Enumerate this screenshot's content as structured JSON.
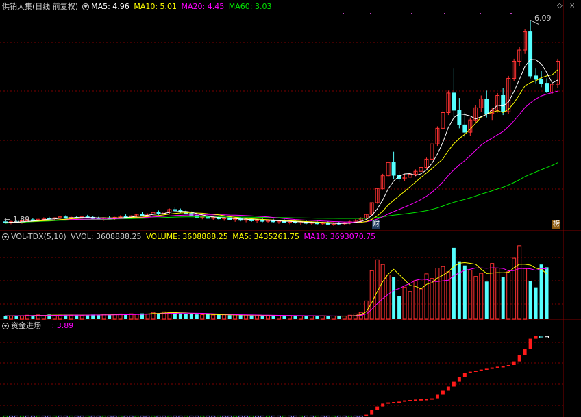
{
  "main_header": {
    "title": "供销大集(日线 前复权)",
    "ma5": "MA5: 4.96",
    "ma10": "MA10: 5.01",
    "ma20": "MA20: 4.45",
    "ma60": "MA60: 3.03"
  },
  "vol_header": {
    "name": "VOL-TDX(5,10)",
    "vvol": "VVOL: 3608888.25",
    "volume": "VOLUME: 3608888.25",
    "ma5": "MA5: 3435261.75",
    "ma10": "MA10: 3693070.75"
  },
  "fund_header": {
    "name": "资金进场",
    "value": ": 3.89"
  },
  "annotations": {
    "high_price": "6.09",
    "low_price": "1.89",
    "tag_cai": "财",
    "tag_bang": "榜"
  },
  "controls": {
    "diamond": "◇",
    "close": "×"
  },
  "colors": {
    "up": "#ff3232",
    "down": "#54ffff",
    "ma5": "#ffffff",
    "ma10": "#ffff00",
    "ma20": "#ff00ff",
    "ma60": "#00e600",
    "grid": "#800000",
    "text": "#c8c8c8"
  },
  "chart_data": [
    {
      "type": "candlestick",
      "title": "供销大集(日线 前复权)",
      "series": [
        {
          "name": "K线",
          "ohlc": [
            [
              1.97,
              2.0,
              1.93,
              1.95
            ],
            [
              1.95,
              1.99,
              1.92,
              1.97
            ],
            [
              1.97,
              2.01,
              1.94,
              1.96
            ],
            [
              1.96,
              2.0,
              1.93,
              1.99
            ],
            [
              1.99,
              2.03,
              1.96,
              2.01
            ],
            [
              2.01,
              2.05,
              1.98,
              2.0
            ],
            [
              2.0,
              2.03,
              1.97,
              2.02
            ],
            [
              2.02,
              2.06,
              1.99,
              2.04
            ],
            [
              2.04,
              2.07,
              2.01,
              2.03
            ],
            [
              2.03,
              2.06,
              2.0,
              2.05
            ],
            [
              2.05,
              2.09,
              2.02,
              2.07
            ],
            [
              2.07,
              2.1,
              2.03,
              2.04
            ],
            [
              2.04,
              2.08,
              2.01,
              2.06
            ],
            [
              2.06,
              2.09,
              2.03,
              2.05
            ],
            [
              2.05,
              2.08,
              2.02,
              2.07
            ],
            [
              2.07,
              2.11,
              2.04,
              2.06
            ],
            [
              2.06,
              2.09,
              2.02,
              2.04
            ],
            [
              2.04,
              2.07,
              2.0,
              2.02
            ],
            [
              2.02,
              2.06,
              1.99,
              2.05
            ],
            [
              2.05,
              2.08,
              2.02,
              2.03
            ],
            [
              2.03,
              2.07,
              2.0,
              2.06
            ],
            [
              2.06,
              2.1,
              2.03,
              2.08
            ],
            [
              2.08,
              2.12,
              2.05,
              2.07
            ],
            [
              2.07,
              2.1,
              2.03,
              2.09
            ],
            [
              2.09,
              2.13,
              2.06,
              2.12
            ],
            [
              2.12,
              2.17,
              2.08,
              2.1
            ],
            [
              2.1,
              2.14,
              2.06,
              2.13
            ],
            [
              2.13,
              2.18,
              2.09,
              2.16
            ],
            [
              2.16,
              2.2,
              2.11,
              2.14
            ],
            [
              2.14,
              2.18,
              2.1,
              2.17
            ],
            [
              2.17,
              2.24,
              2.13,
              2.22
            ],
            [
              2.22,
              2.27,
              2.18,
              2.2
            ],
            [
              2.2,
              2.24,
              2.15,
              2.17
            ],
            [
              2.17,
              2.21,
              2.12,
              2.14
            ],
            [
              2.14,
              2.18,
              2.09,
              2.1
            ],
            [
              2.1,
              2.14,
              2.04,
              2.06
            ],
            [
              2.06,
              2.1,
              2.02,
              2.08
            ],
            [
              2.08,
              2.11,
              2.03,
              2.04
            ],
            [
              2.04,
              2.08,
              2.0,
              2.06
            ],
            [
              2.06,
              2.09,
              2.01,
              2.03
            ],
            [
              2.03,
              2.07,
              1.99,
              2.05
            ],
            [
              2.05,
              2.08,
              2.0,
              2.01
            ],
            [
              2.01,
              2.05,
              1.97,
              2.03
            ],
            [
              2.03,
              2.06,
              1.98,
              2.0
            ],
            [
              2.0,
              2.04,
              1.96,
              2.02
            ],
            [
              2.02,
              2.05,
              1.97,
              1.99
            ],
            [
              1.99,
              2.03,
              1.95,
              2.01
            ],
            [
              2.01,
              2.04,
              1.96,
              1.98
            ],
            [
              1.98,
              2.02,
              1.94,
              2.0
            ],
            [
              2.0,
              2.03,
              1.95,
              1.97
            ],
            [
              1.97,
              2.01,
              1.93,
              1.99
            ],
            [
              1.99,
              2.02,
              1.94,
              1.96
            ],
            [
              1.96,
              2.0,
              1.92,
              1.98
            ],
            [
              1.98,
              2.01,
              1.93,
              1.95
            ],
            [
              1.95,
              1.99,
              1.91,
              1.97
            ],
            [
              1.97,
              2.0,
              1.92,
              1.94
            ],
            [
              1.94,
              1.98,
              1.91,
              1.96
            ],
            [
              1.96,
              1.99,
              1.91,
              1.93
            ],
            [
              1.93,
              1.97,
              1.9,
              1.95
            ],
            [
              1.95,
              1.98,
              1.9,
              1.92
            ],
            [
              1.92,
              1.96,
              1.89,
              1.94
            ],
            [
              1.94,
              1.97,
              1.9,
              1.93
            ],
            [
              1.93,
              1.97,
              1.9,
              1.95
            ],
            [
              1.95,
              1.99,
              1.92,
              1.97
            ],
            [
              1.97,
              2.02,
              1.94,
              2.0
            ],
            [
              2.0,
              2.06,
              1.97,
              2.04
            ],
            [
              2.04,
              2.12,
              2.01,
              2.12
            ],
            [
              2.12,
              2.36,
              2.1,
              2.36
            ],
            [
              2.36,
              2.65,
              2.34,
              2.65
            ],
            [
              2.65,
              2.95,
              2.63,
              2.91
            ],
            [
              2.91,
              3.2,
              2.88,
              3.18
            ],
            [
              3.18,
              3.4,
              2.85,
              2.92
            ],
            [
              2.92,
              3.0,
              2.78,
              2.85
            ],
            [
              2.85,
              2.94,
              2.8,
              2.88
            ],
            [
              2.88,
              2.98,
              2.84,
              2.94
            ],
            [
              2.94,
              3.04,
              2.9,
              3.0
            ],
            [
              3.0,
              3.12,
              2.96,
              3.08
            ],
            [
              3.08,
              3.28,
              3.05,
              3.25
            ],
            [
              3.25,
              3.6,
              3.22,
              3.56
            ],
            [
              3.56,
              3.92,
              3.52,
              3.88
            ],
            [
              3.88,
              4.25,
              3.85,
              4.2
            ],
            [
              4.2,
              4.65,
              4.15,
              4.6
            ],
            [
              4.6,
              5.1,
              4.1,
              4.25
            ],
            [
              4.25,
              4.5,
              3.88,
              3.95
            ],
            [
              3.95,
              4.2,
              3.7,
              3.8
            ],
            [
              3.8,
              4.1,
              3.72,
              4.05
            ],
            [
              4.05,
              4.35,
              4.0,
              4.3
            ],
            [
              4.3,
              4.55,
              4.22,
              4.48
            ],
            [
              4.48,
              4.65,
              4.1,
              4.18
            ],
            [
              4.18,
              4.3,
              4.05,
              4.25
            ],
            [
              4.25,
              4.6,
              4.2,
              4.55
            ],
            [
              4.55,
              4.7,
              4.15,
              4.22
            ],
            [
              4.22,
              4.95,
              4.18,
              4.9
            ],
            [
              4.9,
              5.3,
              4.85,
              5.25
            ],
            [
              5.25,
              5.55,
              5.15,
              5.48
            ],
            [
              5.48,
              5.9,
              5.4,
              5.85
            ],
            [
              5.85,
              6.09,
              4.9,
              4.95
            ],
            [
              4.95,
              5.1,
              4.8,
              4.88
            ],
            [
              4.88,
              5.05,
              4.72,
              4.8
            ],
            [
              4.8,
              4.9,
              4.6,
              4.62
            ],
            [
              4.62,
              4.8,
              4.58,
              4.78
            ],
            [
              4.78,
              5.3,
              4.7,
              5.25
            ]
          ]
        }
      ],
      "ma_lines": [
        "MA5",
        "MA10",
        "MA20",
        "MA60"
      ],
      "ylim": [
        1.8,
        6.25
      ],
      "max_label": "6.09",
      "min_label": "1.89",
      "grid": true
    },
    {
      "type": "bar",
      "title": "VOL-TDX(5,10)",
      "values": [
        130,
        120,
        145,
        125,
        150,
        140,
        160,
        135,
        175,
        150,
        155,
        165,
        140,
        170,
        145,
        160,
        175,
        150,
        190,
        165,
        180,
        200,
        170,
        205,
        190,
        220,
        200,
        260,
        230,
        280,
        250,
        240,
        220,
        210,
        195,
        180,
        170,
        185,
        160,
        175,
        165,
        150,
        160,
        145,
        155,
        140,
        150,
        135,
        145,
        130,
        140,
        125,
        135,
        120,
        130,
        118,
        128,
        115,
        122,
        110,
        118,
        112,
        120,
        150,
        200,
        260,
        700,
        1860,
        2280,
        2100,
        1700,
        1620,
        880,
        1230,
        1060,
        1480,
        1160,
        1740,
        1560,
        1960,
        2020,
        1820,
        2740,
        2220,
        2060,
        1880,
        1640,
        1760,
        1440,
        2140,
        1960,
        1620,
        1820,
        2340,
        2820,
        1940,
        1470,
        1220,
        2100,
        1990
      ],
      "vol_scale": "×10000 shares",
      "ylim": [
        0,
        3000
      ]
    },
    {
      "type": "bar",
      "title": "资金进场",
      "values": [
        0.02,
        0.02,
        0.02,
        0.02,
        0.02,
        0.02,
        0.02,
        0.02,
        0.02,
        0.02,
        0.02,
        0.02,
        0.02,
        0.02,
        0.02,
        0.02,
        0.02,
        0.02,
        0.02,
        0.02,
        0.02,
        0.02,
        0.02,
        0.02,
        0.02,
        0.02,
        0.02,
        0.02,
        0.02,
        0.02,
        0.02,
        0.02,
        0.02,
        0.02,
        0.02,
        0.02,
        0.02,
        0.02,
        0.02,
        0.02,
        0.02,
        0.02,
        0.02,
        0.02,
        0.02,
        0.02,
        0.02,
        0.02,
        0.02,
        0.02,
        0.02,
        0.02,
        0.02,
        0.02,
        0.02,
        0.02,
        0.02,
        0.02,
        0.02,
        0.02,
        0.02,
        0.02,
        0.02,
        0.02,
        0.02,
        0.02,
        0.08,
        0.3,
        0.48,
        0.62,
        0.68,
        0.7,
        0.72,
        0.78,
        0.8,
        0.82,
        0.84,
        0.85,
        0.88,
        1.05,
        1.25,
        1.45,
        1.68,
        1.92,
        2.1,
        2.18,
        2.2,
        2.28,
        2.32,
        2.38,
        2.42,
        2.45,
        2.5,
        2.68,
        2.98,
        3.3,
        3.78,
        3.9,
        3.89,
        3.89
      ],
      "ylim": [
        0,
        4.2
      ]
    }
  ]
}
